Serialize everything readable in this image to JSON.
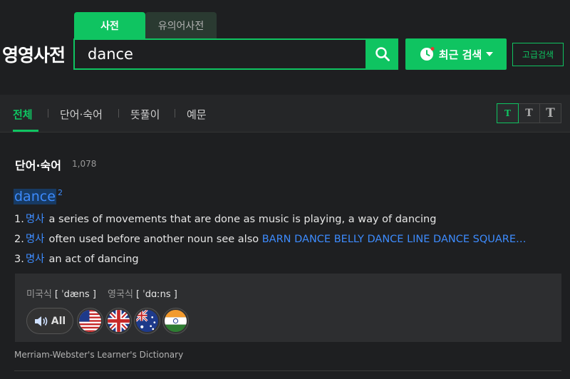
{
  "header": {
    "logo": "영영사전",
    "tabs": [
      "사전",
      "유의어사전"
    ],
    "search_value": "dance",
    "recent_label": "최근 검색",
    "advanced_label": "고급검색"
  },
  "nav": {
    "items": [
      "전체",
      "단어·숙어",
      "뜻풀이",
      "예문"
    ],
    "font_sizes": [
      "T",
      "T",
      "T"
    ]
  },
  "section": {
    "title": "단어·숙어",
    "count": "1,078"
  },
  "entry": {
    "word": "dance",
    "superscript": "2",
    "definitions": [
      {
        "num": "1.",
        "pos": "명사",
        "text": "a series of movements that are done as music is playing, a way of dancing"
      },
      {
        "num": "2.",
        "pos": "명사",
        "text": "often used before another noun see also ",
        "links": "BARN DANCE BELLY DANCE LINE DANCE SQUARE…"
      },
      {
        "num": "3.",
        "pos": "명사",
        "text": "an act of dancing"
      }
    ],
    "pronunciation": {
      "us_label": "미국식",
      "us_value": "[ ˈdæns ]",
      "uk_label": "영국식",
      "uk_value": "[ ˈdɑːns ]",
      "all_label": "All",
      "flags": [
        "us-flag-icon",
        "uk-flag-icon",
        "au-flag-icon",
        "in-flag-icon"
      ]
    },
    "source": "Merriam-Webster's Learner's Dictionary"
  },
  "colors": {
    "accent": "#0fc461",
    "link": "#3d8bfd",
    "background": "#1e1f21"
  }
}
